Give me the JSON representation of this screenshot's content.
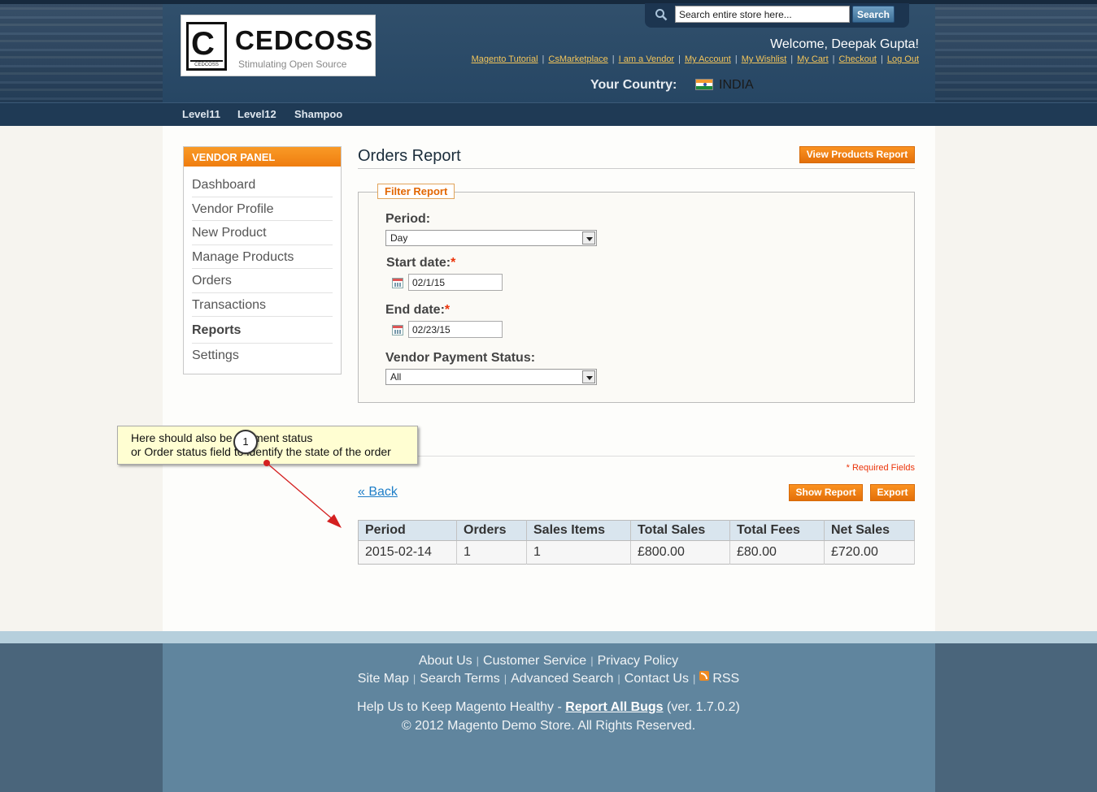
{
  "header": {
    "logo": {
      "name": "CEDCOSS",
      "tagline": "Stimulating Open Source",
      "mark_letter": "C",
      "mark_small": "CEDCOSS"
    },
    "search": {
      "placeholder": "Search entire store here...",
      "button": "Search"
    },
    "welcome": "Welcome, Deepak Gupta!",
    "links": [
      "Magento Tutorial",
      "CsMarketplace",
      "I am a Vendor",
      "My Account",
      "My Wishlist",
      "My Cart",
      "Checkout",
      "Log Out"
    ],
    "country_label": "Your Country:",
    "country_name": "INDIA"
  },
  "nav": [
    "Level11",
    "Level12",
    "Shampoo"
  ],
  "sidebar": {
    "title": "VENDOR PANEL",
    "items": [
      "Dashboard",
      "Vendor Profile",
      "New Product",
      "Manage Products",
      "Orders",
      "Transactions",
      "Reports",
      "Settings"
    ],
    "active": "Reports"
  },
  "page": {
    "title": "Orders Report",
    "view_products_button": "View Products Report",
    "filter": {
      "legend": "Filter Report",
      "period_label": "Period:",
      "period_value": "Day",
      "start_label": "Start date:",
      "start_value": "02/1/15",
      "end_label": "End date:",
      "end_value": "02/23/15",
      "status_label": "Vendor Payment Status:",
      "status_value": "All",
      "required_mark": "*"
    },
    "required_note": "* Required Fields",
    "back": "« Back",
    "show_report_button": "Show Report",
    "export_button": "Export",
    "table": {
      "headers": [
        "Period",
        "Orders",
        "Sales Items",
        "Total Sales",
        "Total Fees",
        "Net Sales"
      ],
      "rows": [
        [
          "2015-02-14",
          "1",
          "1",
          "£800.00",
          "£80.00",
          "£720.00"
        ]
      ]
    }
  },
  "annotation": {
    "line1": "Here should also be payment status",
    "line2": "or Order status field to identify the state of the order",
    "badge": "1"
  },
  "footer": {
    "row1": [
      "About Us",
      "Customer Service",
      "Privacy Policy"
    ],
    "row2": [
      "Site Map",
      "Search Terms",
      "Advanced Search",
      "Contact Us",
      "RSS"
    ],
    "help_prefix": "Help Us to Keep Magento Healthy - ",
    "help_link": "Report All Bugs",
    "help_suffix": " (ver. 1.7.0.2)",
    "copyright": "© 2012 Magento Demo Store. All Rights Reserved."
  },
  "colors": {
    "accent": "#f18200",
    "header_bg": "#2c4661",
    "footer_bg": "#60859e",
    "link": "#1e7ec8"
  }
}
